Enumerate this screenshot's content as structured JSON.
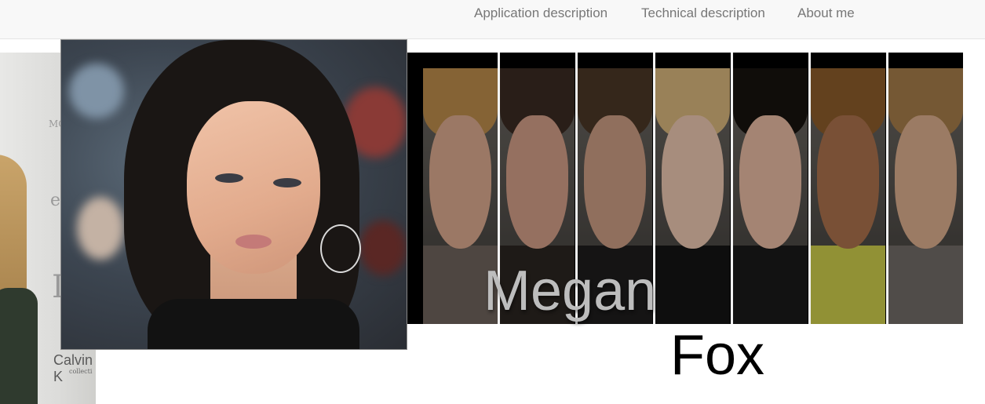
{
  "nav": {
    "links": [
      {
        "label": "Application description"
      },
      {
        "label": "Technical description"
      },
      {
        "label": "About me"
      }
    ]
  },
  "background": {
    "text": [
      "MO",
      "e",
      "I",
      "Calvin K",
      "collecti"
    ]
  },
  "featured": {
    "first_name": "Megan",
    "last_name": "Fox"
  },
  "gallery": {
    "tiles": [
      {
        "hair": "#b98a4a",
        "skin": "#d7a78d",
        "body": "#6d625a"
      },
      {
        "hair": "#3a2a22",
        "skin": "#cf9c86",
        "body": "#2a2420"
      },
      {
        "hair": "#4a3626",
        "skin": "#c89a82",
        "body": "#1e1c1c"
      },
      {
        "hair": "#d5b37a",
        "skin": "#e8c4ad",
        "body": "#141414"
      },
      {
        "hair": "#17130f",
        "skin": "#e3b7a0",
        "body": "#1a1a1a"
      },
      {
        "hair": "#8a5b2a",
        "skin": "#a8704b",
        "body": "#c9c94a"
      },
      {
        "hair": "#a37a49",
        "skin": "#d7ab8b",
        "body": "#6f6a66"
      }
    ]
  }
}
